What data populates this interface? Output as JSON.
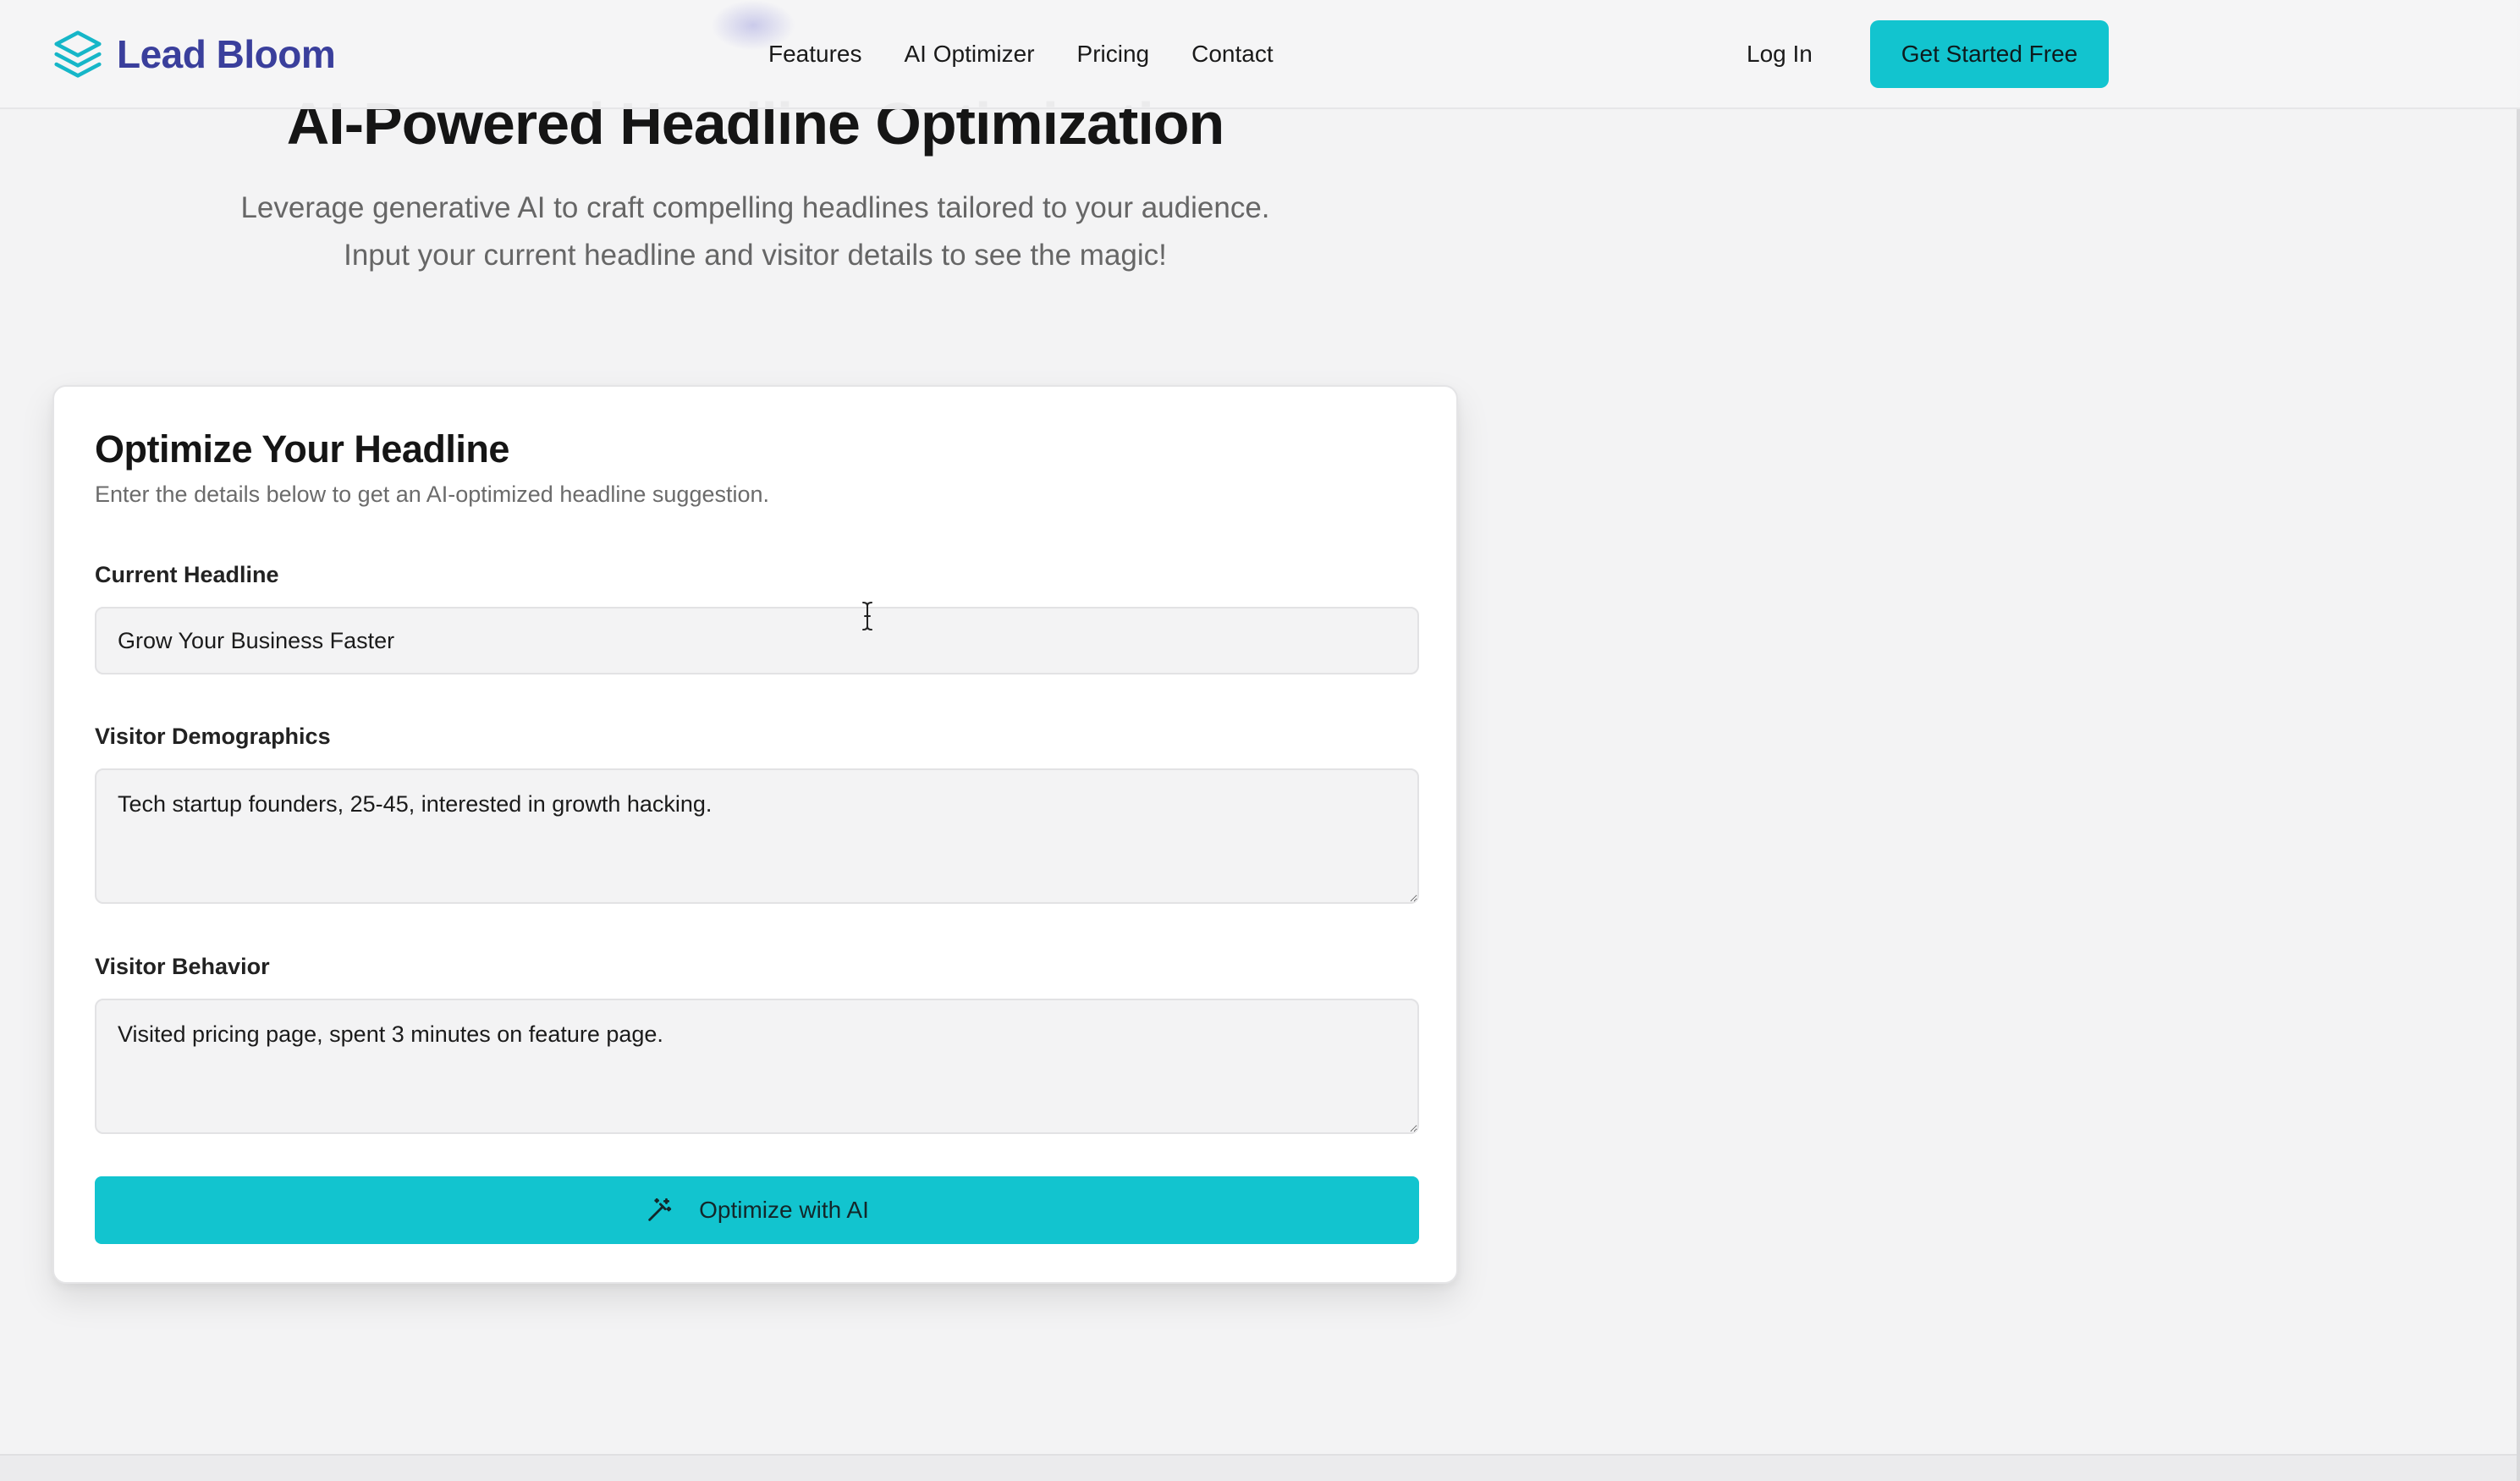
{
  "header": {
    "brand_name": "Lead Bloom",
    "nav": [
      {
        "label": "Features"
      },
      {
        "label": "AI Optimizer"
      },
      {
        "label": "Pricing"
      },
      {
        "label": "Contact"
      }
    ],
    "login_label": "Log In",
    "cta_label": "Get Started Free"
  },
  "hero": {
    "title": "AI-Powered Headline Optimization",
    "subtitle_line1": "Leverage generative AI to craft compelling headlines tailored to your audience.",
    "subtitle_line2": "Input your current headline and visitor details to see the magic!"
  },
  "form": {
    "title": "Optimize Your Headline",
    "subtitle": "Enter the details below to get an AI-optimized headline suggestion.",
    "current_headline": {
      "label": "Current Headline",
      "value": "Grow Your Business Faster"
    },
    "demographics": {
      "label": "Visitor Demographics",
      "value": "Tech startup founders, 25-45, interested in growth hacking."
    },
    "behavior": {
      "label": "Visitor Behavior",
      "value": "Visited pricing page, spent 3 minutes on feature page."
    },
    "submit_label": "Optimize with AI"
  },
  "icons": {
    "brand": "layers-icon",
    "submit": "magic-wand-icon",
    "cursor": "text-cursor-icon"
  },
  "colors": {
    "brand": "#3a3f9c",
    "accent": "#12c4cf",
    "background": "#f3f3f4"
  }
}
